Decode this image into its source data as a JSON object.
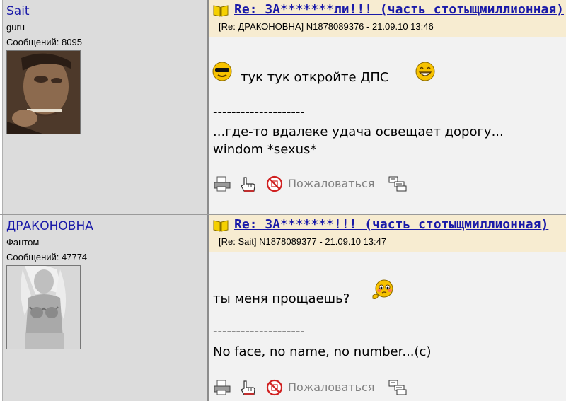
{
  "posts": [
    {
      "author": "Sait",
      "rank": "guru",
      "message_count": "Сообщений: 8095",
      "title": "Re: ЗА*******ли!!! (часть стотыщмиллионная)",
      "meta": "[Re: ДРАКОНОВНА]  N1878089376 - 21.09.10 13:46",
      "body_text": "тук тук откройте ДПС",
      "divider": "--------------------",
      "signature_lines": [
        "...где-то вдалеке удача освещает дорогу...",
        "windom *sexus*"
      ],
      "report_label": "Пожаловаться",
      "smileys": [
        "cool-sunglasses-smiley-icon",
        "grin-smiley-icon"
      ]
    },
    {
      "author": "ДРАКОНОВНА",
      "rank": "Фантом",
      "message_count": "Сообщений: 47774",
      "title": "Re: ЗА*******!!! (часть стотыщмиллионная)",
      "meta": "[Re: Sait]  N1878089377 - 21.09.10 13:47",
      "body_text": "ты меня прощаешь?",
      "divider": "--------------------",
      "signature_lines": [
        "No face, no name, no number...(c)"
      ],
      "report_label": "Пожаловаться",
      "smileys": [
        "shy-pleading-smiley-icon"
      ]
    }
  ],
  "colors": {
    "link": "#1a1aa8",
    "header_bg": "#f7ecd1",
    "user_bg": "#dcdcdc",
    "message_bg": "#f2f2f2"
  }
}
